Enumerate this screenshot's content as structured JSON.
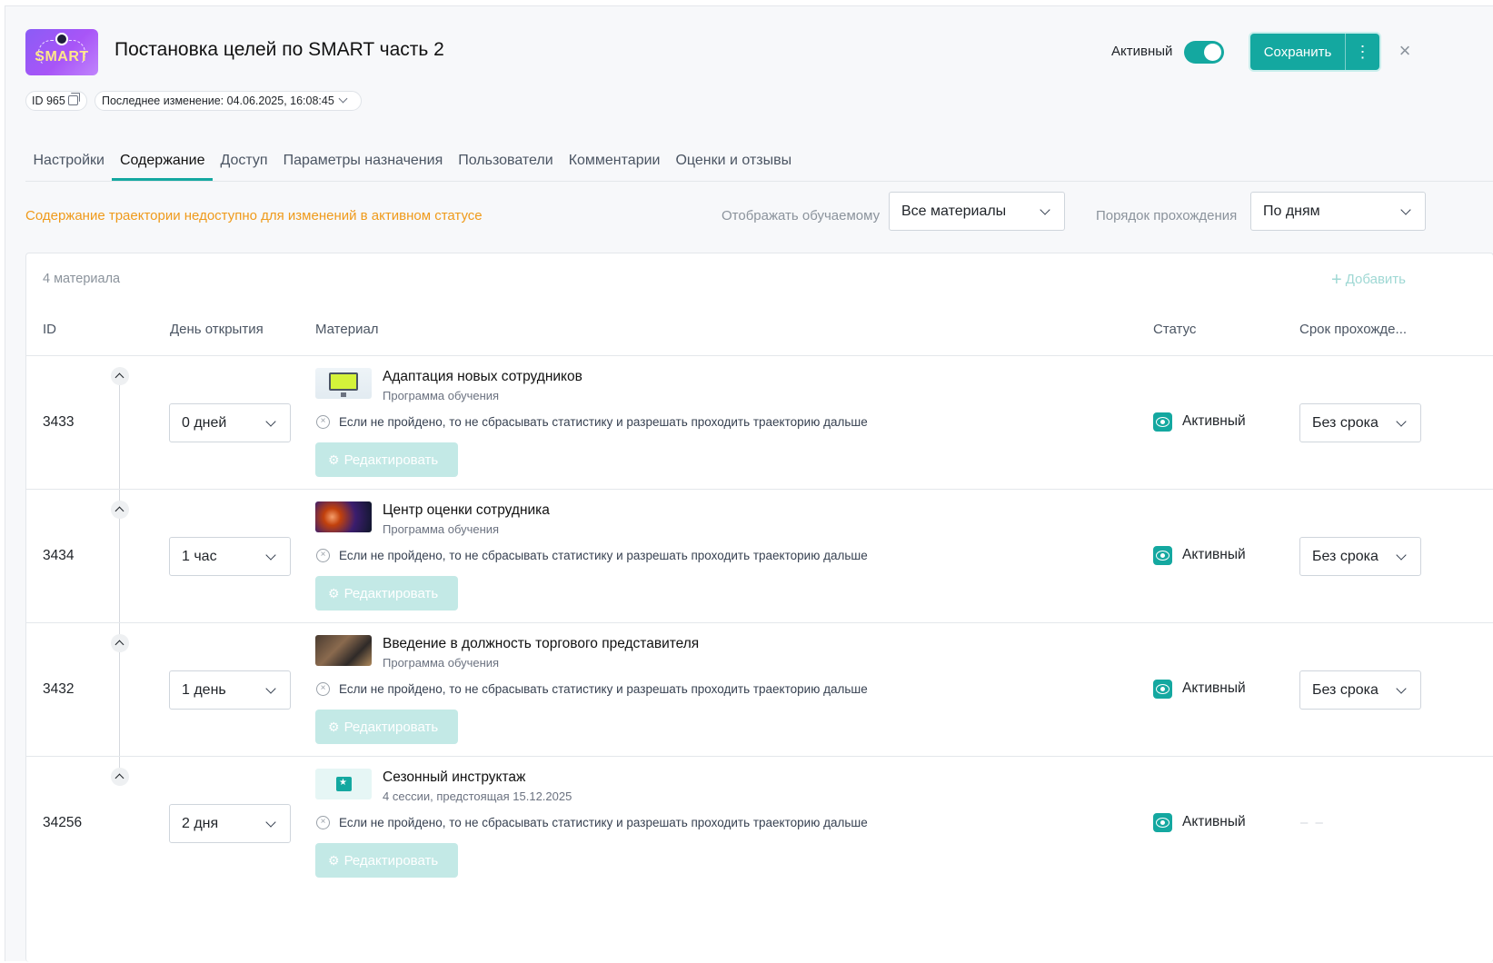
{
  "header": {
    "logo_text": "SMART",
    "title": "Постановка целей по SMART часть 2",
    "active_label": "Активный",
    "active_toggle_on": true,
    "save_label": "Сохранить",
    "more_label": "⋮",
    "close_label": "×"
  },
  "meta": {
    "id_label": "ID 965",
    "last_change_label": "Последнее изменение: 04.06.2025, 16:08:45"
  },
  "tabs": [
    {
      "label": "Настройки",
      "active": false
    },
    {
      "label": "Содержание",
      "active": true
    },
    {
      "label": "Доступ",
      "active": false
    },
    {
      "label": "Параметры назначения",
      "active": false
    },
    {
      "label": "Пользователи",
      "active": false
    },
    {
      "label": "Комментарии",
      "active": false
    },
    {
      "label": "Оценки и отзывы",
      "active": false
    }
  ],
  "content": {
    "warning": "Содержание траектории недоступно для изменений в активном статусе",
    "show_label": "Отображать обучаемому",
    "show_value": "Все материалы",
    "order_label": "Порядок прохождения",
    "order_value": "По дням"
  },
  "table": {
    "count_label": "4 материала",
    "add_label": "Добавить",
    "columns": {
      "id": "ID",
      "open_day": "День открытия",
      "material": "Материал",
      "status": "Статус",
      "deadline": "Срок прохожде..."
    },
    "edit_label": "Редактировать",
    "rows": [
      {
        "id": "3433",
        "open_day": "0 дней",
        "title": "Адаптация новых сотрудников",
        "subtitle": "Программа обучения",
        "rule": "Если не пройдено, то не сбрасывать статистику и разрешать проходить траекторию дальше",
        "status": "Активный",
        "deadline": "Без срока"
      },
      {
        "id": "3434",
        "open_day": "1 час",
        "title": "Центр оценки сотрудника",
        "subtitle": "Программа обучения",
        "rule": "Если не пройдено, то не сбрасывать статистику и разрешать проходить траекторию дальше",
        "status": "Активный",
        "deadline": "Без срока"
      },
      {
        "id": "3432",
        "open_day": "1 день",
        "title": "Введение в должность торгового представителя",
        "subtitle": "Программа обучения",
        "rule": "Если не пройдено, то не сбрасывать статистику и разрешать проходить траекторию дальше",
        "status": "Активный",
        "deadline": "Без срока"
      },
      {
        "id": "34256",
        "open_day": "2 дня",
        "title": "Сезонный инструктаж",
        "subtitle": "4 сессии, предстоящая 15.12.2025",
        "rule": "Если не пройдено, то не сбрасывать статистику и разрешать проходить траекторию дальше",
        "status": "Активный",
        "deadline": "– –"
      }
    ]
  },
  "colors": {
    "accent": "#14a8a0",
    "warning": "#ef9a1a"
  }
}
